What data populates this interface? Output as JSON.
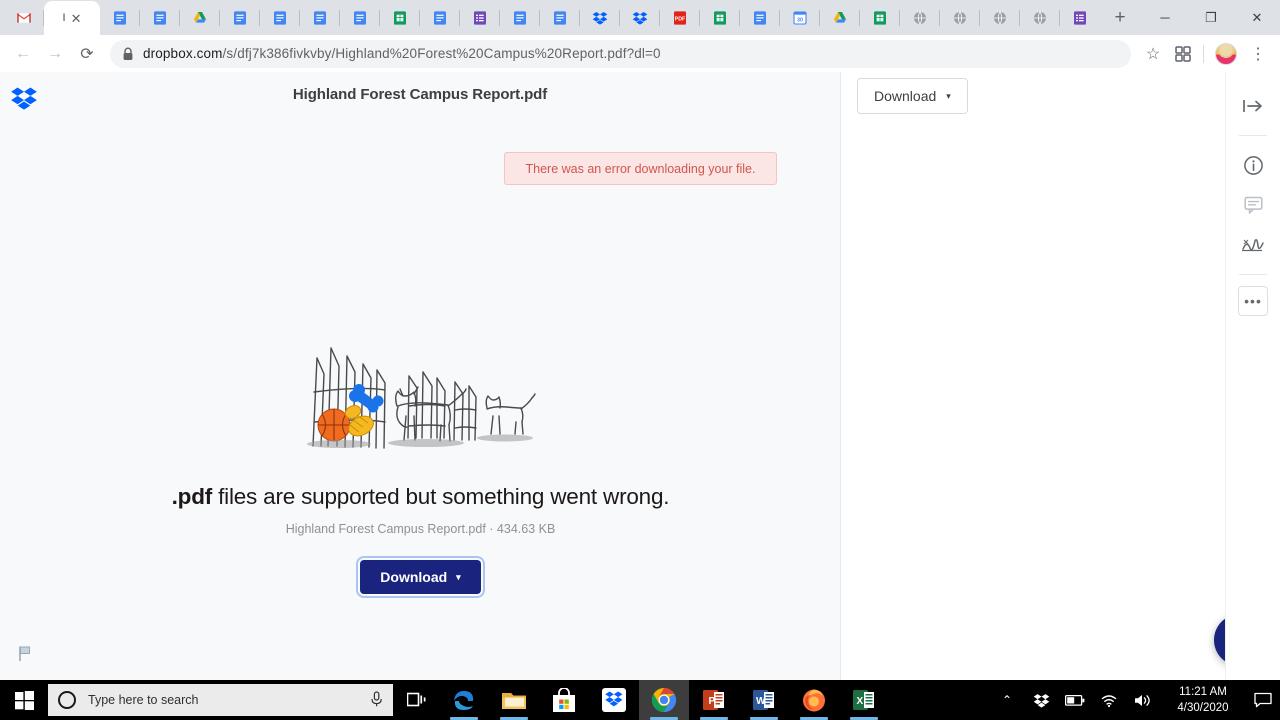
{
  "browser": {
    "tabs": [
      {
        "name": "gmail-tab",
        "icon": "gmail-icon"
      },
      {
        "name": "active-tab-dropbox",
        "icon": "generic-icon",
        "title": "I",
        "close": "✕",
        "active": true
      },
      {
        "name": "google-docs-tab-1",
        "icon": "docs-icon"
      },
      {
        "name": "google-docs-tab-2",
        "icon": "docs-icon"
      },
      {
        "name": "google-drive-tab-1",
        "icon": "drive-icon"
      },
      {
        "name": "google-docs-tab-3",
        "icon": "docs-icon"
      },
      {
        "name": "google-docs-tab-4",
        "icon": "docs-icon"
      },
      {
        "name": "google-docs-tab-5",
        "icon": "docs-icon"
      },
      {
        "name": "google-docs-tab-6",
        "icon": "docs-icon"
      },
      {
        "name": "google-sheets-tab-1",
        "icon": "sheets-icon"
      },
      {
        "name": "google-docs-tab-7",
        "icon": "docs-icon"
      },
      {
        "name": "google-forms-tab-1",
        "icon": "forms-icon"
      },
      {
        "name": "google-docs-tab-8",
        "icon": "docs-icon"
      },
      {
        "name": "google-docs-tab-9",
        "icon": "docs-icon"
      },
      {
        "name": "dropbox-tab-1",
        "icon": "dropbox-icon"
      },
      {
        "name": "dropbox-tab-2",
        "icon": "dropbox-icon"
      },
      {
        "name": "pdf-tab",
        "icon": "pdf-icon"
      },
      {
        "name": "google-sheets-tab-2",
        "icon": "sheets-icon"
      },
      {
        "name": "google-docs-tab-10",
        "icon": "docs-icon"
      },
      {
        "name": "google-calendar-tab",
        "icon": "calendar-icon",
        "day": "30"
      },
      {
        "name": "google-drive-tab-2",
        "icon": "drive-icon"
      },
      {
        "name": "google-sheets-tab-3",
        "icon": "sheets-icon"
      },
      {
        "name": "globe-tab-1",
        "icon": "globe-icon"
      },
      {
        "name": "globe-tab-2",
        "icon": "globe-icon"
      },
      {
        "name": "globe-tab-3",
        "icon": "globe-icon"
      },
      {
        "name": "globe-tab-4",
        "icon": "globe-icon"
      },
      {
        "name": "google-forms-tab-2",
        "icon": "forms-icon"
      }
    ],
    "new_tab_label": "+",
    "window_controls": {
      "minimize": "─",
      "maximize": "❐",
      "close": "✕"
    },
    "nav": {
      "back": "←",
      "forward": "→",
      "reload": "⟳"
    },
    "omnibox": {
      "lock_icon": "lock-icon",
      "url_domain": "dropbox.com",
      "url_path": "/s/dfj7k386fivkvby/Highland%20Forest%20Campus%20Report.pdf?dl=0"
    },
    "toolbar_right": {
      "bookmark": "☆",
      "extensions": "extensions-icon",
      "profile": "profile-avatar",
      "menu": "⋮"
    }
  },
  "dropbox": {
    "logo": "dropbox-logo",
    "document_title": "Highland Forest Campus Report.pdf",
    "error_banner": {
      "message": "There was an error downloading your file."
    },
    "illustration": "dogs-fence-sketch-illustration",
    "headline_bold": ".pdf",
    "headline_rest": " files are supported but something went wrong.",
    "file_meta": "Highland Forest Campus Report.pdf · 434.63 KB",
    "primary_download": {
      "label": "Download",
      "caret": "▾",
      "color": "#1a237e"
    },
    "secondary_download": {
      "label": "Download",
      "caret": "▾"
    },
    "flag_button": "report-flag-icon",
    "chat_button": "support-chat-icon",
    "rail": [
      {
        "name": "collapse-panel-icon",
        "label": "collapse"
      },
      {
        "name": "info-icon",
        "label": "info"
      },
      {
        "name": "comment-icon",
        "label": "comments"
      },
      {
        "name": "signature-icon",
        "label": "signature"
      },
      {
        "name": "more-options-icon",
        "label": "•••"
      }
    ]
  },
  "taskbar": {
    "start": "windows-start-icon",
    "search_placeholder": "Type here to search",
    "cortana_icon": "cortana-circle-icon",
    "mic_icon": "microphone-icon",
    "task_view_icon": "task-view-icon",
    "apps": [
      {
        "name": "taskbar-edge",
        "icon": "edge-icon",
        "open": true,
        "active": false
      },
      {
        "name": "taskbar-file-explorer",
        "icon": "file-explorer-icon",
        "open": true,
        "active": false
      },
      {
        "name": "taskbar-microsoft-store",
        "icon": "store-icon",
        "open": false,
        "active": false
      },
      {
        "name": "taskbar-dropbox",
        "icon": "dropbox-app-icon",
        "open": false,
        "active": false
      },
      {
        "name": "taskbar-chrome",
        "icon": "chrome-icon",
        "open": true,
        "active": true
      },
      {
        "name": "taskbar-powerpoint",
        "icon": "powerpoint-icon",
        "open": true,
        "active": false
      },
      {
        "name": "taskbar-word",
        "icon": "word-icon",
        "open": true,
        "active": false
      },
      {
        "name": "taskbar-firefox",
        "icon": "firefox-icon",
        "open": true,
        "active": false
      },
      {
        "name": "taskbar-excel",
        "icon": "excel-icon",
        "open": true,
        "active": false
      }
    ],
    "tray": {
      "chevron": "⌃",
      "dropbox": "dropbox-tray-icon",
      "battery": "battery-icon",
      "wifi": "wifi-icon",
      "volume": "volume-icon",
      "time": "11:21 AM",
      "date": "4/30/2020",
      "action_center": "action-center-icon"
    }
  }
}
